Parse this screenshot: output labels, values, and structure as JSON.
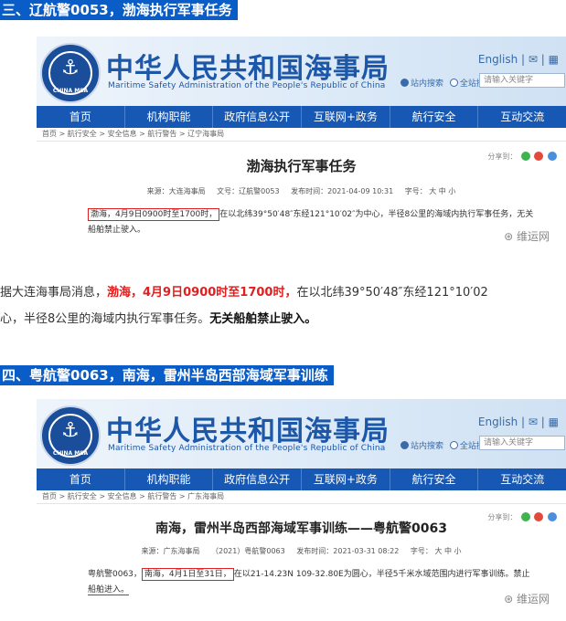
{
  "section3": {
    "title": "三、辽航警0053，渤海执行军事任务",
    "screenshot": {
      "site_cn": "中华人民共和国海事局",
      "site_en": "Maritime Safety Administration of the People's Republic of China",
      "logo_text": "CHINA MSA",
      "lang": "English",
      "radio_site": "站内搜索",
      "radio_all": "全站搜索",
      "search_placeholder": "请输入关键字",
      "nav": [
        "首页",
        "机构职能",
        "政府信息公开",
        "互联网+政务",
        "航行安全",
        "互动交流"
      ],
      "breadcrumb": "首页 > 航行安全 > 安全信息 > 航行警告 > 辽宁海事局",
      "share_label": "分享到：",
      "article_title": "渤海执行军事任务",
      "source": "来源：大连海事局",
      "doc_no": "文号：辽航警0053",
      "publish_time": "发布时间：2021-04-09 10:31",
      "font_size": "字号：  大   中   小",
      "body_highlight": "渤海，4月9日0900时至1700时，",
      "body_rest": "在以北纬39°50′48″东经121°10′02″为中心，半径8公里的海域内执行军事任务，无关",
      "body_line2": "船舶禁止驶入。",
      "watermark": "维运网"
    },
    "para_lead": "据大连海事局消息，",
    "para_red": "渤海，4月9日0900时至1700时，",
    "para_rest": "在以北纬39°50′48″东经121°10′02",
    "para_line2_a": "心，半径8公里的海域内执行军事任务。",
    "para_line2_bold": "无关船舶禁止驶入。"
  },
  "section4": {
    "title": "四、粤航警0063，南海，雷州半岛西部海域军事训练",
    "screenshot": {
      "site_cn": "中华人民共和国海事局",
      "site_en": "Maritime Safety Administration of the People's Republic of China",
      "logo_text": "CHINA MSA",
      "lang": "English",
      "radio_site": "站内搜索",
      "radio_all": "全站搜索",
      "search_placeholder": "请输入关键字",
      "nav": [
        "首页",
        "机构职能",
        "政府信息公开",
        "互联网+政务",
        "航行安全",
        "互动交流"
      ],
      "breadcrumb": "首页 > 航行安全 > 安全信息 > 航行警告 > 广东海事局",
      "share_label": "分享到：",
      "article_title": "南海，雷州半岛西部海域军事训练——粤航警0063",
      "source": "来源：广东海事局",
      "doc_no": "（2021）粤航警0063",
      "publish_time": "发布时间：2021-03-31 08:22",
      "font_size": "字号：  大   中   小",
      "body_lead": "粤航警0063，",
      "body_highlight": "南海，4月1日至31日，",
      "body_rest": "在以21-14.23N 109-32.80E为圆心，半径5千米水域范围内进行军事训练。禁止",
      "body_line2": "船舶进入。",
      "watermark": "维运网"
    }
  },
  "colors": {
    "title_bar": "#0a5cc7",
    "highlight": "#e02020",
    "nav": "#1658b3",
    "brand_text": "#1d57a8"
  }
}
